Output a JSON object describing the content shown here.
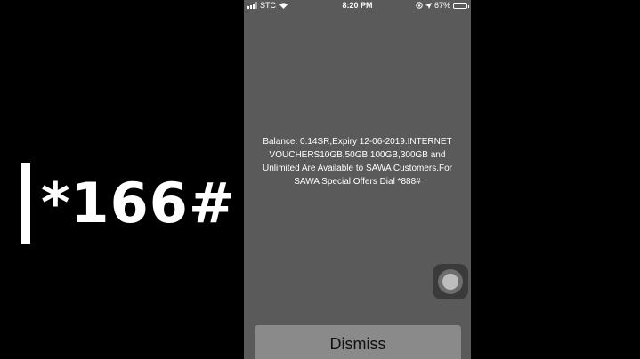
{
  "overlay": {
    "code": "*166#"
  },
  "status_bar": {
    "carrier": "STC",
    "time": "8:20 PM",
    "battery": "67%",
    "battery_level": 0.67
  },
  "dialog": {
    "message": "Balance: 0.14SR,Expiry 12-06-2019.INTERNET VOUCHERS10GB,50GB,100GB,300GB and Unlimited Are Available to SAWA Customers.For SAWA Special Offers Dial *888#",
    "dismiss_label": "Dismiss"
  },
  "colors": {
    "background": "#000000",
    "dialog_background": "#5a5a5a",
    "button_background": "#8a8a8a"
  },
  "icons": {
    "signal": "signal-icon",
    "wifi": "wifi-icon",
    "location": "location-icon",
    "lock_rotation": "lock-rotation-icon",
    "battery": "battery-icon",
    "assistive_touch": "assistive-touch-icon"
  }
}
